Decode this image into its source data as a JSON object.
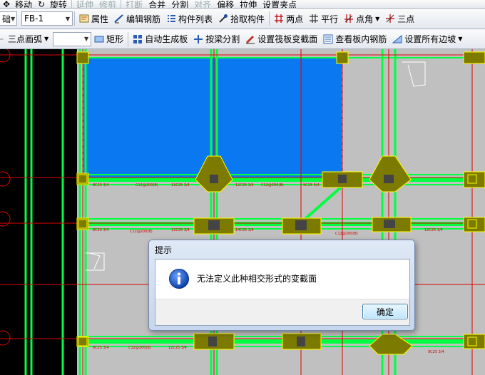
{
  "toolbar_top": {
    "items": [
      "移动",
      "旋转",
      "延伸",
      "修剪",
      "打断",
      "合并",
      "分割",
      "对齐",
      "偏移",
      "拉伸",
      "设置夹点"
    ]
  },
  "toolbar1": {
    "layer_combo": "础",
    "element_combo": "FB-1",
    "properties": "属性",
    "edit_rebar": "编辑钢筋",
    "member_list": "构件列表",
    "pick_member": "拾取构件",
    "two_points": "两点",
    "parallel": "平行",
    "point_angle": "点角",
    "three_point": "三点"
  },
  "toolbar2": {
    "arc_mode": "三点画弧",
    "blank_combo": "",
    "rectangle": "矩形",
    "auto_generate": "自动生成板",
    "split_by_beam": "按梁分割",
    "set_raft_section": "设置筏板变截面",
    "view_rebar": "查看板内钢筋",
    "set_all_slopes": "设置所有边坡"
  },
  "dialog": {
    "title": "提示",
    "message": "无法定义此种相交形式的变截面",
    "ok": "确定"
  },
  "colors": {
    "blue_fill": "#0a78f0",
    "green_line": "#00ff40",
    "red_axis": "#e00000",
    "olive_block": "#7d7a00",
    "yellow_outline": "#ffff00"
  }
}
